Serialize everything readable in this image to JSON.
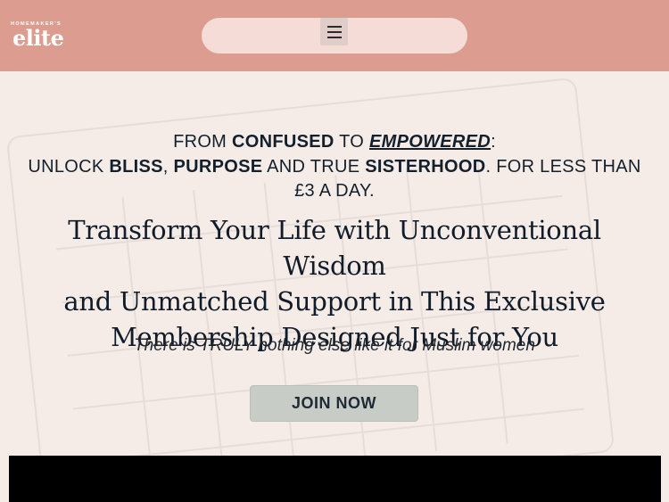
{
  "header": {
    "logo_small": "HOMEMAKER'S",
    "logo_main": "elite",
    "menu_icon": "hamburger-menu-icon"
  },
  "hero": {
    "line1": {
      "p1": "FROM ",
      "p2": "CONFUSED",
      "p3": " TO ",
      "p4": "EMPOWERED",
      "p5": ":"
    },
    "line2": {
      "p1": "UNLOCK ",
      "p2": "BLISS",
      "p3": ", ",
      "p4": "PURPOSE",
      "p5": " AND TRUE ",
      "p6": "SISTERHOOD",
      "p7": ". FOR LESS THAN"
    },
    "line3": "£3 A DAY.",
    "title": {
      "l1": "Transform Your Life with Unconventional Wisdom",
      "l2": "and Unmatched Support in This Exclusive",
      "l3": "Membership Designed Just for You"
    },
    "subtitle": "There is TRULY nothing else like it for Muslim women",
    "cta_label": "JOIN NOW"
  },
  "colors": {
    "header_bg": "#dc9c90",
    "nav_pill_bg": "#f6dcd7",
    "page_bg": "#f6ece7",
    "button_bg": "#c8ccc6",
    "text_dark": "#12202e",
    "video_bg": "#000000"
  }
}
